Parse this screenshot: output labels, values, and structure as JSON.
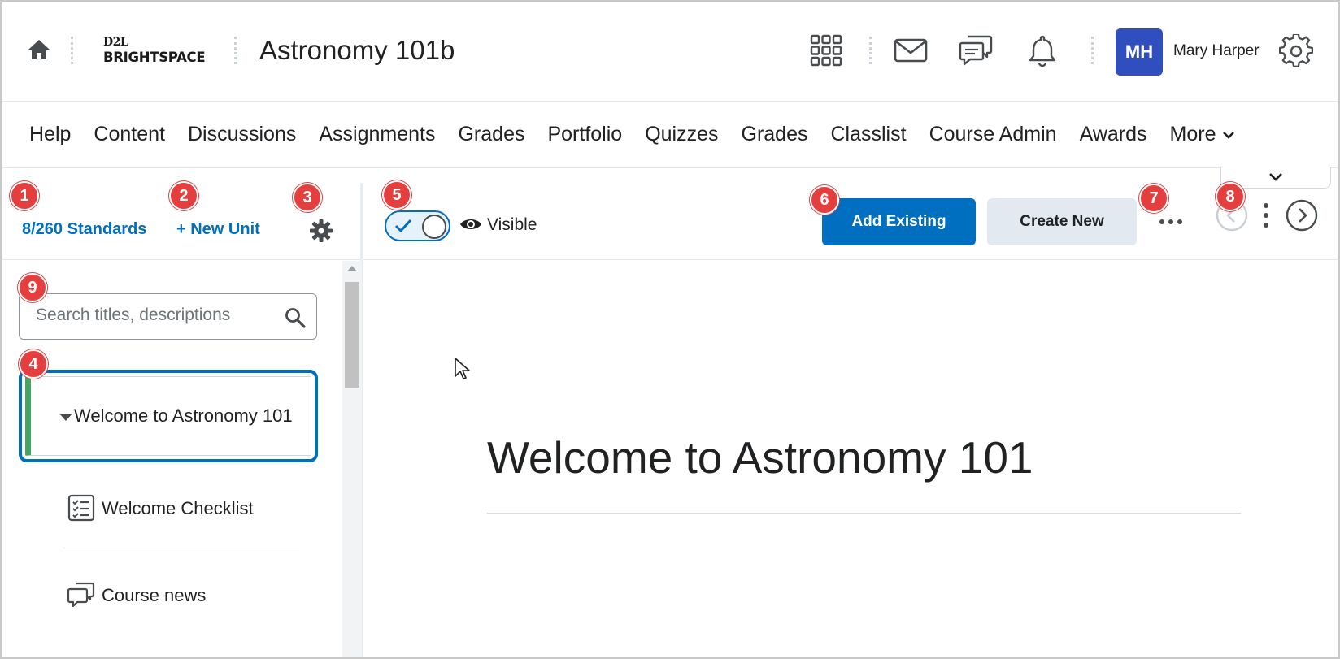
{
  "header": {
    "logo_top": "D2L",
    "logo_bottom": "BRIGHTSPACE",
    "course_title": "Astronomy 101b",
    "user_initials": "MH",
    "user_name": "Mary Harper",
    "avatar_color": "#2f4fbf"
  },
  "nav": {
    "items": [
      "Help",
      "Content",
      "Discussions",
      "Assignments",
      "Grades",
      "Portfolio",
      "Quizzes",
      "Grades",
      "Classlist",
      "Course Admin",
      "Awards",
      "More"
    ]
  },
  "left_panel": {
    "standards_link": "8/260 Standards",
    "new_unit_link": "+ New Unit",
    "search_placeholder": "Search titles, descriptions",
    "unit": {
      "title": "Welcome to Astronomy 101",
      "accent_color": "#46a661"
    },
    "lessons": [
      {
        "label": "Welcome Checklist",
        "icon": "checklist-icon"
      },
      {
        "label": "Course news",
        "icon": "discussion-icon"
      }
    ]
  },
  "toolbar": {
    "visibility_label": "Visible",
    "visibility_on": true,
    "add_existing": "Add Existing",
    "create_new": "Create New"
  },
  "content": {
    "heading": "Welcome to Astronomy 101"
  },
  "callouts": [
    "1",
    "2",
    "3",
    "4",
    "5",
    "6",
    "7",
    "8",
    "9"
  ],
  "colors": {
    "primary": "#006fbf",
    "callout": "#e53e3e",
    "secondary_button": "#e3e9f1"
  }
}
